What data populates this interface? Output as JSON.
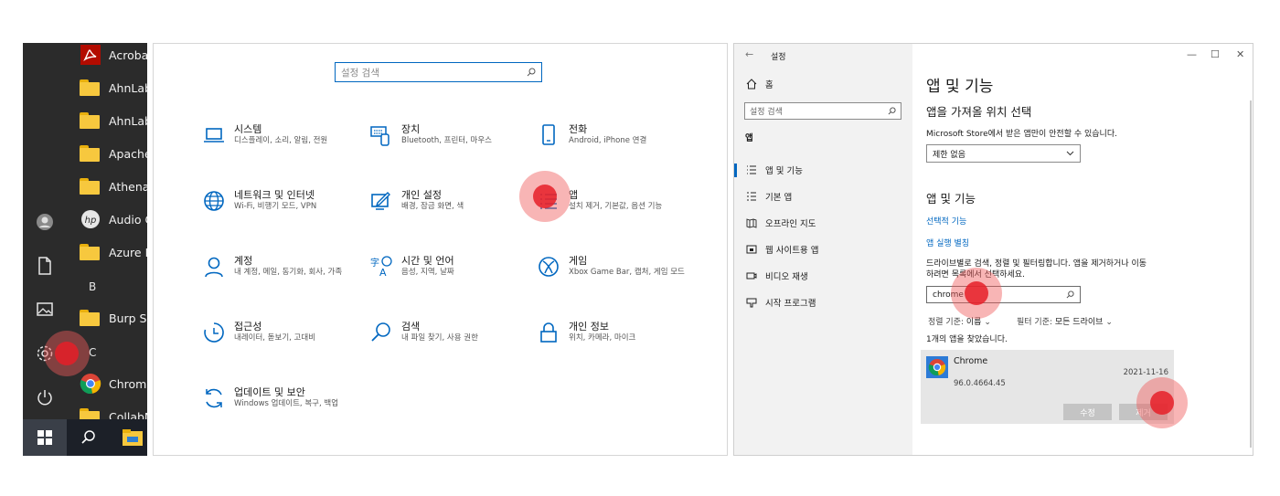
{
  "start_menu": {
    "apps": [
      {
        "label": "Acrobat",
        "icon": "acrobat-icon"
      },
      {
        "label": "AhnLab",
        "icon": "folder-icon"
      },
      {
        "label": "AhnLab",
        "icon": "folder-icon"
      },
      {
        "label": "Apache",
        "icon": "folder-icon"
      },
      {
        "label": "Athena",
        "icon": "folder-icon"
      },
      {
        "label": "Audio C",
        "icon": "hp-icon"
      },
      {
        "label": "Azure D",
        "icon": "folder-icon"
      },
      {
        "label": "Burp Su",
        "icon": "folder-icon"
      },
      {
        "label": "Chrome",
        "icon": "chrome-icon"
      },
      {
        "label": "CollabN",
        "icon": "folder-icon"
      }
    ],
    "letters": [
      "B",
      "C"
    ],
    "rail_icons": [
      "user-icon",
      "document-icon",
      "pictures-icon",
      "settings-gear-icon",
      "power-icon"
    ]
  },
  "settings_home": {
    "search_placeholder": "설정 검색",
    "tiles": [
      {
        "title": "시스템",
        "subtitle": "디스플레이, 소리, 알림, 전원",
        "icon": "laptop-icon"
      },
      {
        "title": "장치",
        "subtitle": "Bluetooth, 프린터, 마우스",
        "icon": "keyboard-icon"
      },
      {
        "title": "전화",
        "subtitle": "Android, iPhone 연결",
        "icon": "phone-icon"
      },
      {
        "title": "네트워크 및 인터넷",
        "subtitle": "Wi-Fi, 비행기 모드, VPN",
        "icon": "globe-icon"
      },
      {
        "title": "개인 설정",
        "subtitle": "배경, 잠금 화면, 색",
        "icon": "personalize-icon"
      },
      {
        "title": "앱",
        "subtitle": "설치 제거, 기본값, 옵션 기능",
        "icon": "apps-list-icon"
      },
      {
        "title": "계정",
        "subtitle": "내 계정, 메일, 동기화, 회사, 가족",
        "icon": "person-icon"
      },
      {
        "title": "시간 및 언어",
        "subtitle": "음성, 지역, 날짜",
        "icon": "time-language-icon"
      },
      {
        "title": "게임",
        "subtitle": "Xbox Game Bar, 캡처, 게임 모드",
        "icon": "xbox-icon"
      },
      {
        "title": "접근성",
        "subtitle": "내레이터, 돋보기, 고대비",
        "icon": "accessibility-icon"
      },
      {
        "title": "검색",
        "subtitle": "내 파일 찾기, 사용 권한",
        "icon": "search-icon"
      },
      {
        "title": "개인 정보",
        "subtitle": "위치, 카메라, 마이크",
        "icon": "lock-icon"
      },
      {
        "title": "업데이트 및 보안",
        "subtitle": "Windows 업데이트, 복구, 백업",
        "icon": "update-icon"
      }
    ]
  },
  "apps_window": {
    "title": "설정",
    "sidebar": {
      "home_label": "홈",
      "search_placeholder": "설정 검색",
      "section_label": "앱",
      "items": [
        {
          "label": "앱 및 기능",
          "icon": "apps-features-icon",
          "selected": true
        },
        {
          "label": "기본 앱",
          "icon": "default-apps-icon"
        },
        {
          "label": "오프라인 지도",
          "icon": "offline-maps-icon"
        },
        {
          "label": "웹 사이트용 앱",
          "icon": "apps-for-websites-icon"
        },
        {
          "label": "비디오 재생",
          "icon": "video-playback-icon"
        },
        {
          "label": "시작 프로그램",
          "icon": "startup-icon"
        }
      ]
    },
    "main": {
      "heading": "앱 및 기능",
      "choose_heading": "앱을 가져올 위치 선택",
      "choose_desc": "Microsoft Store에서 받은 앱만이 안전할 수 있습니다.",
      "choose_value": "제한 없음",
      "features_heading": "앱 및 기능",
      "link_optional": "선택적 기능",
      "link_aliases": "앱 실행 별칭",
      "search_desc_1": "드라이브별로 검색, 정렬 및 필터링합니다. 앱을 제거하거나 이동",
      "search_desc_2": "하려면 목록에서 선택하세요.",
      "search_value": "chrome",
      "sort_label": "정렬 기준:",
      "sort_value": "이름",
      "filter_label": "필터 기준:",
      "filter_value": "모든 드라이브",
      "found_text": "1개의 앱을 찾았습니다.",
      "app": {
        "name": "Chrome",
        "version": "96.0.4664.45",
        "date": "2021-11-16",
        "modify_label": "수정",
        "uninstall_label": "제거"
      }
    }
  },
  "colors": {
    "accent": "#0067c0",
    "start_bg": "#2b2b2b",
    "marker": "#e61e28"
  }
}
